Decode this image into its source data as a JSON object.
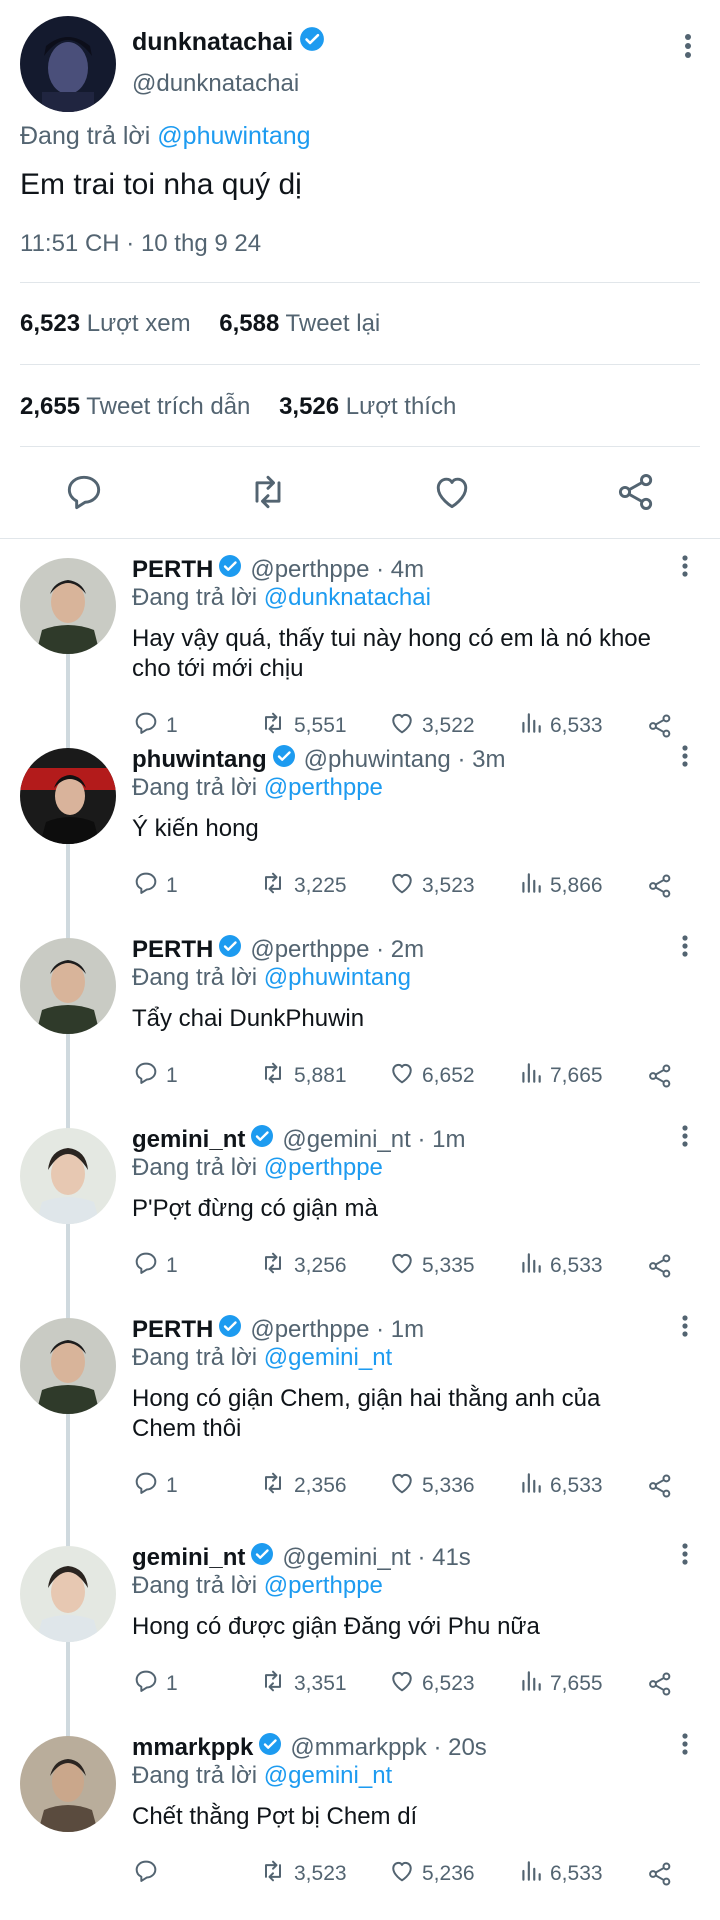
{
  "main_tweet": {
    "name": "dunknatachai",
    "handle": "@dunknatachai",
    "replying_prefix": "Đang trả lời",
    "replying_to": "@phuwintang",
    "text": "Em trai toi nha quý dị",
    "timestamp": "11:51 CH · 10 thg 9 24",
    "views_count": "6,523",
    "views_label": "Lượt xem",
    "retweets_count": "6,588",
    "retweets_label": "Tweet lại",
    "quotes_count": "2,655",
    "quotes_label": "Tweet trích dẫn",
    "likes_count": "3,526",
    "likes_label": "Lượt thích"
  },
  "replies": [
    {
      "name": "PERTH",
      "handle": "@perthppe · 4m",
      "replying_to": "@dunknatachai",
      "text_lines": [
        "Hay vậy quá, thấy tui này hong có em là nó khoe",
        "cho tới mới chịu"
      ],
      "replies": "1",
      "retweets": "5,551",
      "likes": "3,522",
      "views": "6,533"
    },
    {
      "name": "phuwintang",
      "handle": "@phuwintang · 3m",
      "replying_to": "@perthppe",
      "text_lines": [
        "Ý kiến hong"
      ],
      "replies": "1",
      "retweets": "3,225",
      "likes": "3,523",
      "views": "5,866"
    },
    {
      "name": "PERTH",
      "handle": "@perthppe · 2m",
      "replying_to": "@phuwintang",
      "text_lines": [
        "Tẩy chai DunkPhuwin"
      ],
      "replies": "1",
      "retweets": "5,881",
      "likes": "6,652",
      "views": "7,665"
    },
    {
      "name": "gemini_nt",
      "handle": "@gemini_nt · 1m",
      "replying_to": "@perthppe",
      "text_lines": [
        "P'Pợt đừng có giận mà"
      ],
      "replies": "1",
      "retweets": "3,256",
      "likes": "5,335",
      "views": "6,533"
    },
    {
      "name": "PERTH",
      "handle": "@perthppe · 1m",
      "replying_to": "@gemini_nt",
      "text_lines": [
        "Hong có giận Chem, giận hai thằng anh của",
        "Chem thôi"
      ],
      "replies": "1",
      "retweets": "2,356",
      "likes": "5,336",
      "views": "6,533"
    },
    {
      "name": "gemini_nt",
      "handle": "@gemini_nt · 41s",
      "replying_to": "@perthppe",
      "text_lines": [
        "Hong có được giận Đăng với Phu nữa"
      ],
      "replies": "1",
      "retweets": "3,351",
      "likes": "6,523",
      "views": "7,655"
    },
    {
      "name": "mmarkppk",
      "handle": "@mmarkppk · 20s",
      "replying_to": "@gemini_nt",
      "text_lines": [
        "Chết thằng Pợt bị Chem dí"
      ],
      "replies": "",
      "retweets": "3,523",
      "likes": "5,236",
      "views": "6,533"
    }
  ],
  "replying_prefix": "Đang trả lời",
  "colors": {
    "accent": "#1d9bf0",
    "secondary_text": "#536471",
    "divider": "#e1e6ea"
  },
  "icons": [
    "verified-badge-icon",
    "more-vertical-icon",
    "reply-icon",
    "retweet-icon",
    "like-icon",
    "share-icon",
    "views-icon"
  ]
}
